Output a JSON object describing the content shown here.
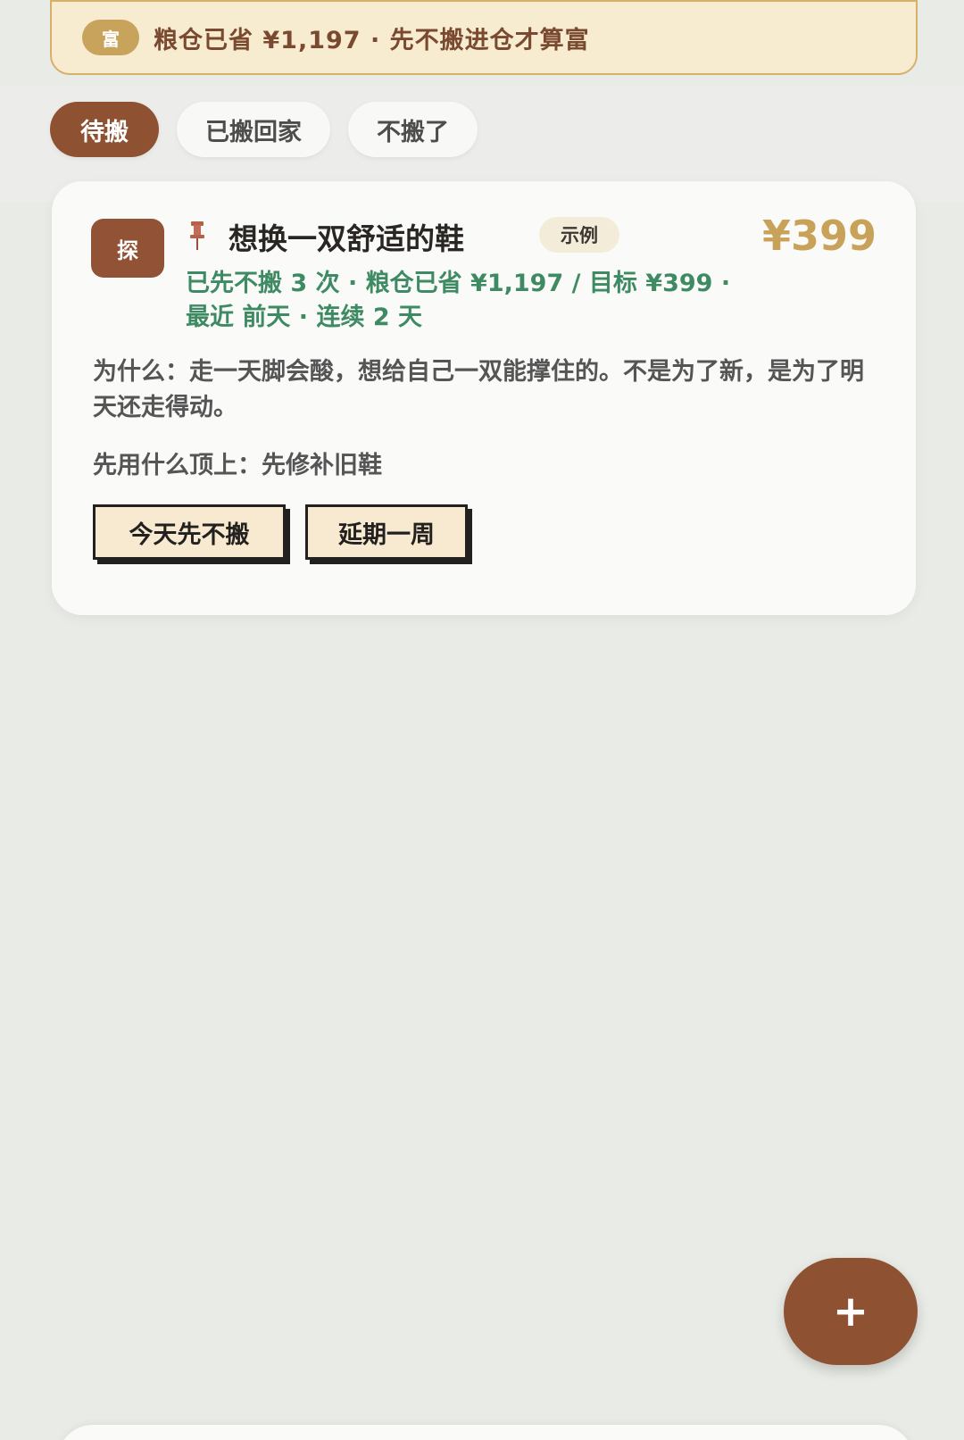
{
  "banner": {
    "badge": "富",
    "text": "粮仓已省 ¥1,197 · 先不搬进仓才算富"
  },
  "tabs": [
    {
      "label": "待搬",
      "active": true
    },
    {
      "label": "已搬回家",
      "active": false
    },
    {
      "label": "不搬了",
      "active": false
    }
  ],
  "card": {
    "category_icon_label": "探",
    "pin_icon": "pushpin-icon",
    "title": "想换一双舒适的鞋",
    "tag": "示例",
    "price": "¥399",
    "meta": "已先不搬 3 次 · 粮仓已省 ¥1,197 / 目标 ¥399 · 最近 前天 · 连续 2 天",
    "reason": "为什么：走一天脚会酸，想给自己一双能撑住的。不是为了新，是为了明天还走得动。",
    "fallback": "先用什么顶上：先修补旧鞋",
    "actions": {
      "primary": "今天先不搬",
      "secondary": "延期一周"
    }
  },
  "fab": {
    "icon": "plus-icon",
    "label": "+"
  },
  "colors": {
    "primary_brown": "#8e5233",
    "gold": "#c9a25a",
    "green_meta": "#3e8a62",
    "banner_bg": "#f7ebd0",
    "button_bg": "#f7ead0"
  }
}
